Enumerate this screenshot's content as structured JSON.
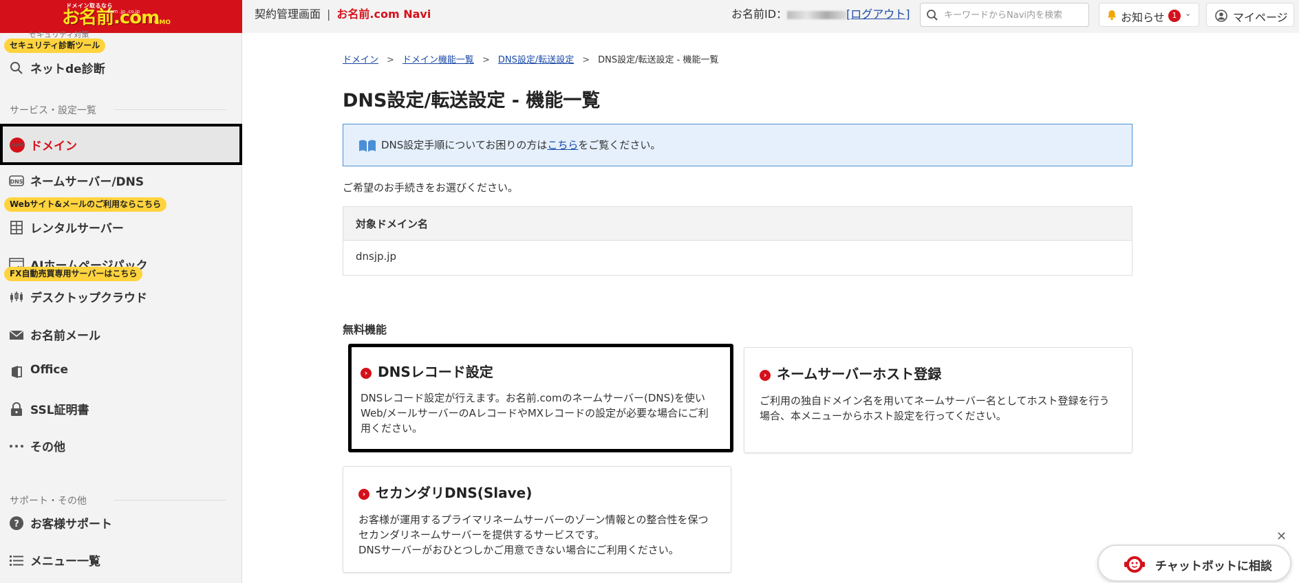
{
  "header": {
    "logo_tagline": "ドメイン取るなら",
    "logo_text": "お名前.com",
    "logo_sub": ".com .jp .co.jp",
    "logo_brand": "GMO",
    "contract_label": "契約管理画面",
    "separator": "|",
    "navi_label": "お名前.com Navi",
    "userid_label": "お名前ID：",
    "logout_label": "[ログアウト]",
    "search_placeholder": "キーワードからNavi内を検索",
    "notice_label": "お知らせ",
    "notice_count": "1",
    "mypage_label": "マイページ"
  },
  "sidebar": {
    "cut_label": "セキュリティ対策",
    "badge_security": "セキュリティ診断ツール",
    "item_netde": "ネットde診断",
    "section_services": "サービス・設定一覧",
    "item_domain": "ドメイン",
    "item_nameserver": "ネームサーバー/DNS",
    "badge_web": "Webサイト&メールのご利用ならこちら",
    "item_rental": "レンタルサーバー",
    "item_ai": "AIホームページパック",
    "badge_fx": "FX自動売買専用サーバーはこちら",
    "item_desktop": "デスクトップクラウド",
    "item_mail": "お名前メール",
    "item_office": "Office",
    "item_ssl": "SSL証明書",
    "item_other": "その他",
    "section_support": "サポート・その他",
    "item_support": "お客様サポート",
    "item_menu": "メニュー一覧"
  },
  "breadcrumb": {
    "items": [
      "ドメイン",
      "ドメイン機能一覧",
      "DNS設定/転送設定"
    ],
    "current": "DNS設定/転送設定 - 機能一覧",
    "separator": ">"
  },
  "page_title": "DNS設定/転送設定 - 機能一覧",
  "info": {
    "before": "DNS設定手順についてお困りの方は",
    "link": "こちら",
    "after": "をご覧ください。"
  },
  "prompt": "ご希望のお手続きをお選びください。",
  "domain_table": {
    "header": "対象ドメイン名",
    "value": "dnsjp.jp"
  },
  "free_section": "無料機能",
  "cards": [
    {
      "title": "DNSレコード設定",
      "desc": "DNSレコード設定が行えます。お名前.comのネームサーバー(DNS)を使いWeb/メールサーバーのAレコードやMXレコードの設定が必要な場合にご利用ください。"
    },
    {
      "title": "ネームサーバーホスト登録",
      "desc": "ご利用の独自ドメイン名を用いてネームサーバー名としてホスト登録を行う場合、本メニューからホスト設定を行ってください。"
    },
    {
      "title": "セカンダリDNS(Slave)",
      "desc": "お客様が運用するプライマリネームサーバーのゾーン情報との整合性を保つセカンダリネームサーバーを提供するサービスです。",
      "desc2": "DNSサーバーがおひとつしかご用意できない場合にご利用ください。"
    }
  ],
  "chatbot": {
    "label": "チャットボットに相談",
    "close": "✕"
  },
  "colors": {
    "brand_red": "#d4111b",
    "badge_yellow": "#ffd33d",
    "link_blue": "#1a49a8",
    "info_bg": "#e5f0fc"
  }
}
